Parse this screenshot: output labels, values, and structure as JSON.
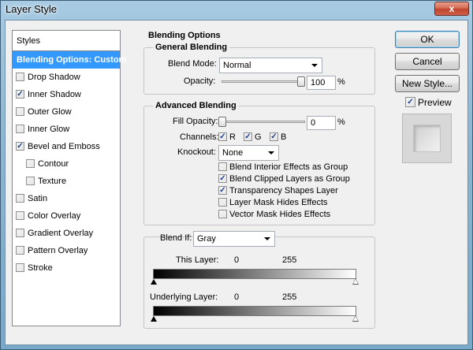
{
  "window": {
    "title": "Layer Style",
    "close_glyph": "x"
  },
  "styles_panel": {
    "header": "Styles",
    "items": [
      {
        "label": "Blending Options: Custom",
        "checked": null,
        "selected": true,
        "sub": false
      },
      {
        "label": "Drop Shadow",
        "checked": false,
        "selected": false,
        "sub": false
      },
      {
        "label": "Inner Shadow",
        "checked": true,
        "selected": false,
        "sub": false
      },
      {
        "label": "Outer Glow",
        "checked": false,
        "selected": false,
        "sub": false
      },
      {
        "label": "Inner Glow",
        "checked": false,
        "selected": false,
        "sub": false
      },
      {
        "label": "Bevel and Emboss",
        "checked": true,
        "selected": false,
        "sub": false
      },
      {
        "label": "Contour",
        "checked": false,
        "selected": false,
        "sub": true
      },
      {
        "label": "Texture",
        "checked": false,
        "selected": false,
        "sub": true
      },
      {
        "label": "Satin",
        "checked": false,
        "selected": false,
        "sub": false
      },
      {
        "label": "Color Overlay",
        "checked": false,
        "selected": false,
        "sub": false
      },
      {
        "label": "Gradient Overlay",
        "checked": false,
        "selected": false,
        "sub": false
      },
      {
        "label": "Pattern Overlay",
        "checked": false,
        "selected": false,
        "sub": false
      },
      {
        "label": "Stroke",
        "checked": false,
        "selected": false,
        "sub": false
      }
    ]
  },
  "blending_options": {
    "title": "Blending Options",
    "general": {
      "title": "General Blending",
      "blend_mode_label": "Blend Mode:",
      "blend_mode_value": "Normal",
      "opacity_label": "Opacity:",
      "opacity_value": "100",
      "opacity_fraction": 1.0,
      "percent": "%"
    },
    "advanced": {
      "title": "Advanced Blending",
      "fill_opacity_label": "Fill Opacity:",
      "fill_opacity_value": "0",
      "fill_opacity_fraction": 0.0,
      "percent": "%",
      "channels_label": "Channels:",
      "channel_r": "R",
      "channel_g": "G",
      "channel_b": "B",
      "knockout_label": "Knockout:",
      "knockout_value": "None",
      "options": [
        {
          "label": "Blend Interior Effects as Group",
          "checked": false
        },
        {
          "label": "Blend Clipped Layers as Group",
          "checked": true
        },
        {
          "label": "Transparency Shapes Layer",
          "checked": true
        },
        {
          "label": "Layer Mask Hides Effects",
          "checked": false
        },
        {
          "label": "Vector Mask Hides Effects",
          "checked": false
        }
      ]
    },
    "blend_if": {
      "label": "Blend If:",
      "value": "Gray",
      "this_layer_label": "This Layer:",
      "this_layer_min": "0",
      "this_layer_max": "255",
      "underlying_label": "Underlying Layer:",
      "underlying_min": "0",
      "underlying_max": "255"
    }
  },
  "buttons": {
    "ok": "OK",
    "cancel": "Cancel",
    "new_style": "New Style...",
    "preview_label": "Preview"
  },
  "check_glyph": "✓",
  "colors": {
    "selection": "#3399ff",
    "dialog_bg": "#f0f0f0",
    "title_bar": "#8cb6d3"
  }
}
